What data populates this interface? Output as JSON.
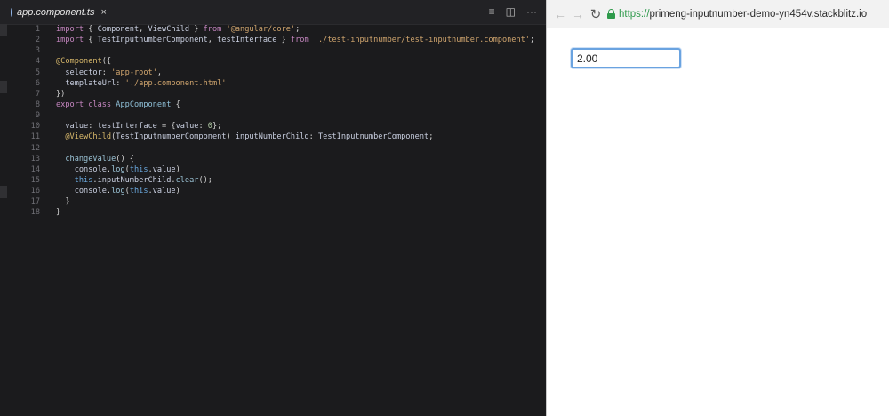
{
  "editor": {
    "tab": {
      "filename": "app.component.ts",
      "close": "×"
    },
    "actions": {
      "split": "≡",
      "layout": "◫",
      "more": "···"
    },
    "lines": [
      {
        "n": "1",
        "tokens": [
          [
            "keyword",
            "import"
          ],
          [
            "plain",
            " { "
          ],
          [
            "ident",
            "Component"
          ],
          [
            "plain",
            ", "
          ],
          [
            "ident",
            "ViewChild"
          ],
          [
            "plain",
            " } "
          ],
          [
            "keyword",
            "from"
          ],
          [
            "plain",
            " "
          ],
          [
            "string",
            "'@angular/core'"
          ],
          [
            "plain",
            ";"
          ]
        ]
      },
      {
        "n": "2",
        "tokens": [
          [
            "keyword",
            "import"
          ],
          [
            "plain",
            " { "
          ],
          [
            "ident",
            "TestInputnumberComponent"
          ],
          [
            "plain",
            ", "
          ],
          [
            "ident",
            "testInterface"
          ],
          [
            "plain",
            " } "
          ],
          [
            "keyword",
            "from"
          ],
          [
            "plain",
            " "
          ],
          [
            "string",
            "'./test-inputnumber/test-inputnumber.component'"
          ],
          [
            "plain",
            ";"
          ]
        ]
      },
      {
        "n": "3",
        "tokens": []
      },
      {
        "n": "4",
        "tokens": [
          [
            "decorator",
            "@Component"
          ],
          [
            "plain",
            "({"
          ]
        ]
      },
      {
        "n": "5",
        "tokens": [
          [
            "plain",
            "  "
          ],
          [
            "ident",
            "selector"
          ],
          [
            "plain",
            ": "
          ],
          [
            "string",
            "'app-root'"
          ],
          [
            "plain",
            ","
          ]
        ]
      },
      {
        "n": "6",
        "tokens": [
          [
            "plain",
            "  "
          ],
          [
            "ident",
            "templateUrl"
          ],
          [
            "plain",
            ": "
          ],
          [
            "string",
            "'./app.component.html'"
          ]
        ]
      },
      {
        "n": "7",
        "tokens": [
          [
            "plain",
            "})"
          ]
        ]
      },
      {
        "n": "8",
        "tokens": [
          [
            "keyword",
            "export"
          ],
          [
            "plain",
            " "
          ],
          [
            "keyword",
            "class"
          ],
          [
            "plain",
            " "
          ],
          [
            "cls",
            "AppComponent"
          ],
          [
            "plain",
            " {"
          ]
        ]
      },
      {
        "n": "9",
        "tokens": []
      },
      {
        "n": "10",
        "tokens": [
          [
            "plain",
            "  "
          ],
          [
            "ident",
            "value"
          ],
          [
            "plain",
            ": "
          ],
          [
            "ident",
            "testInterface"
          ],
          [
            "plain",
            " = {"
          ],
          [
            "ident",
            "value"
          ],
          [
            "plain",
            ": "
          ],
          [
            "number",
            "0"
          ],
          [
            "plain",
            "};"
          ]
        ]
      },
      {
        "n": "11",
        "tokens": [
          [
            "plain",
            "  "
          ],
          [
            "decorator",
            "@ViewChild"
          ],
          [
            "plain",
            "("
          ],
          [
            "ident",
            "TestInputnumberComponent"
          ],
          [
            "plain",
            ") "
          ],
          [
            "ident",
            "inputNumberChild"
          ],
          [
            "plain",
            ": "
          ],
          [
            "ident",
            "TestInputnumberComponent"
          ],
          [
            "plain",
            ";"
          ]
        ]
      },
      {
        "n": "12",
        "tokens": []
      },
      {
        "n": "13",
        "tokens": [
          [
            "plain",
            "  "
          ],
          [
            "func",
            "changeValue"
          ],
          [
            "plain",
            "() {"
          ]
        ]
      },
      {
        "n": "14",
        "tokens": [
          [
            "plain",
            "    "
          ],
          [
            "ident",
            "console"
          ],
          [
            "plain",
            "."
          ],
          [
            "func",
            "log"
          ],
          [
            "plain",
            "("
          ],
          [
            "this",
            "this"
          ],
          [
            "plain",
            "."
          ],
          [
            "ident",
            "value"
          ],
          [
            "plain",
            ")"
          ]
        ]
      },
      {
        "n": "15",
        "tokens": [
          [
            "plain",
            "    "
          ],
          [
            "this",
            "this"
          ],
          [
            "plain",
            "."
          ],
          [
            "ident",
            "inputNumberChild"
          ],
          [
            "plain",
            "."
          ],
          [
            "func",
            "clear"
          ],
          [
            "plain",
            "();"
          ]
        ]
      },
      {
        "n": "16",
        "tokens": [
          [
            "plain",
            "    "
          ],
          [
            "ident",
            "console"
          ],
          [
            "plain",
            "."
          ],
          [
            "func",
            "log"
          ],
          [
            "plain",
            "("
          ],
          [
            "this",
            "this"
          ],
          [
            "plain",
            "."
          ],
          [
            "ident",
            "value"
          ],
          [
            "plain",
            ")"
          ]
        ]
      },
      {
        "n": "17",
        "tokens": [
          [
            "plain",
            "  }"
          ]
        ]
      },
      {
        "n": "18",
        "tokens": [
          [
            "plain",
            "}"
          ]
        ]
      }
    ]
  },
  "browser": {
    "nav": {
      "back": "←",
      "forward": "→",
      "reload": "↻"
    },
    "url": {
      "scheme": "https://",
      "host": "primeng-inputnumber-demo-yn454v.stackblitz.io"
    },
    "input_value": "2.00"
  },
  "colors": {
    "editor_bg": "#1b1b1d",
    "keyword": "#c586c0",
    "string": "#d0a56e",
    "decorator": "#d9b96b",
    "secure_green": "#2e9a4b",
    "focus_blue": "#6aa3e0"
  }
}
